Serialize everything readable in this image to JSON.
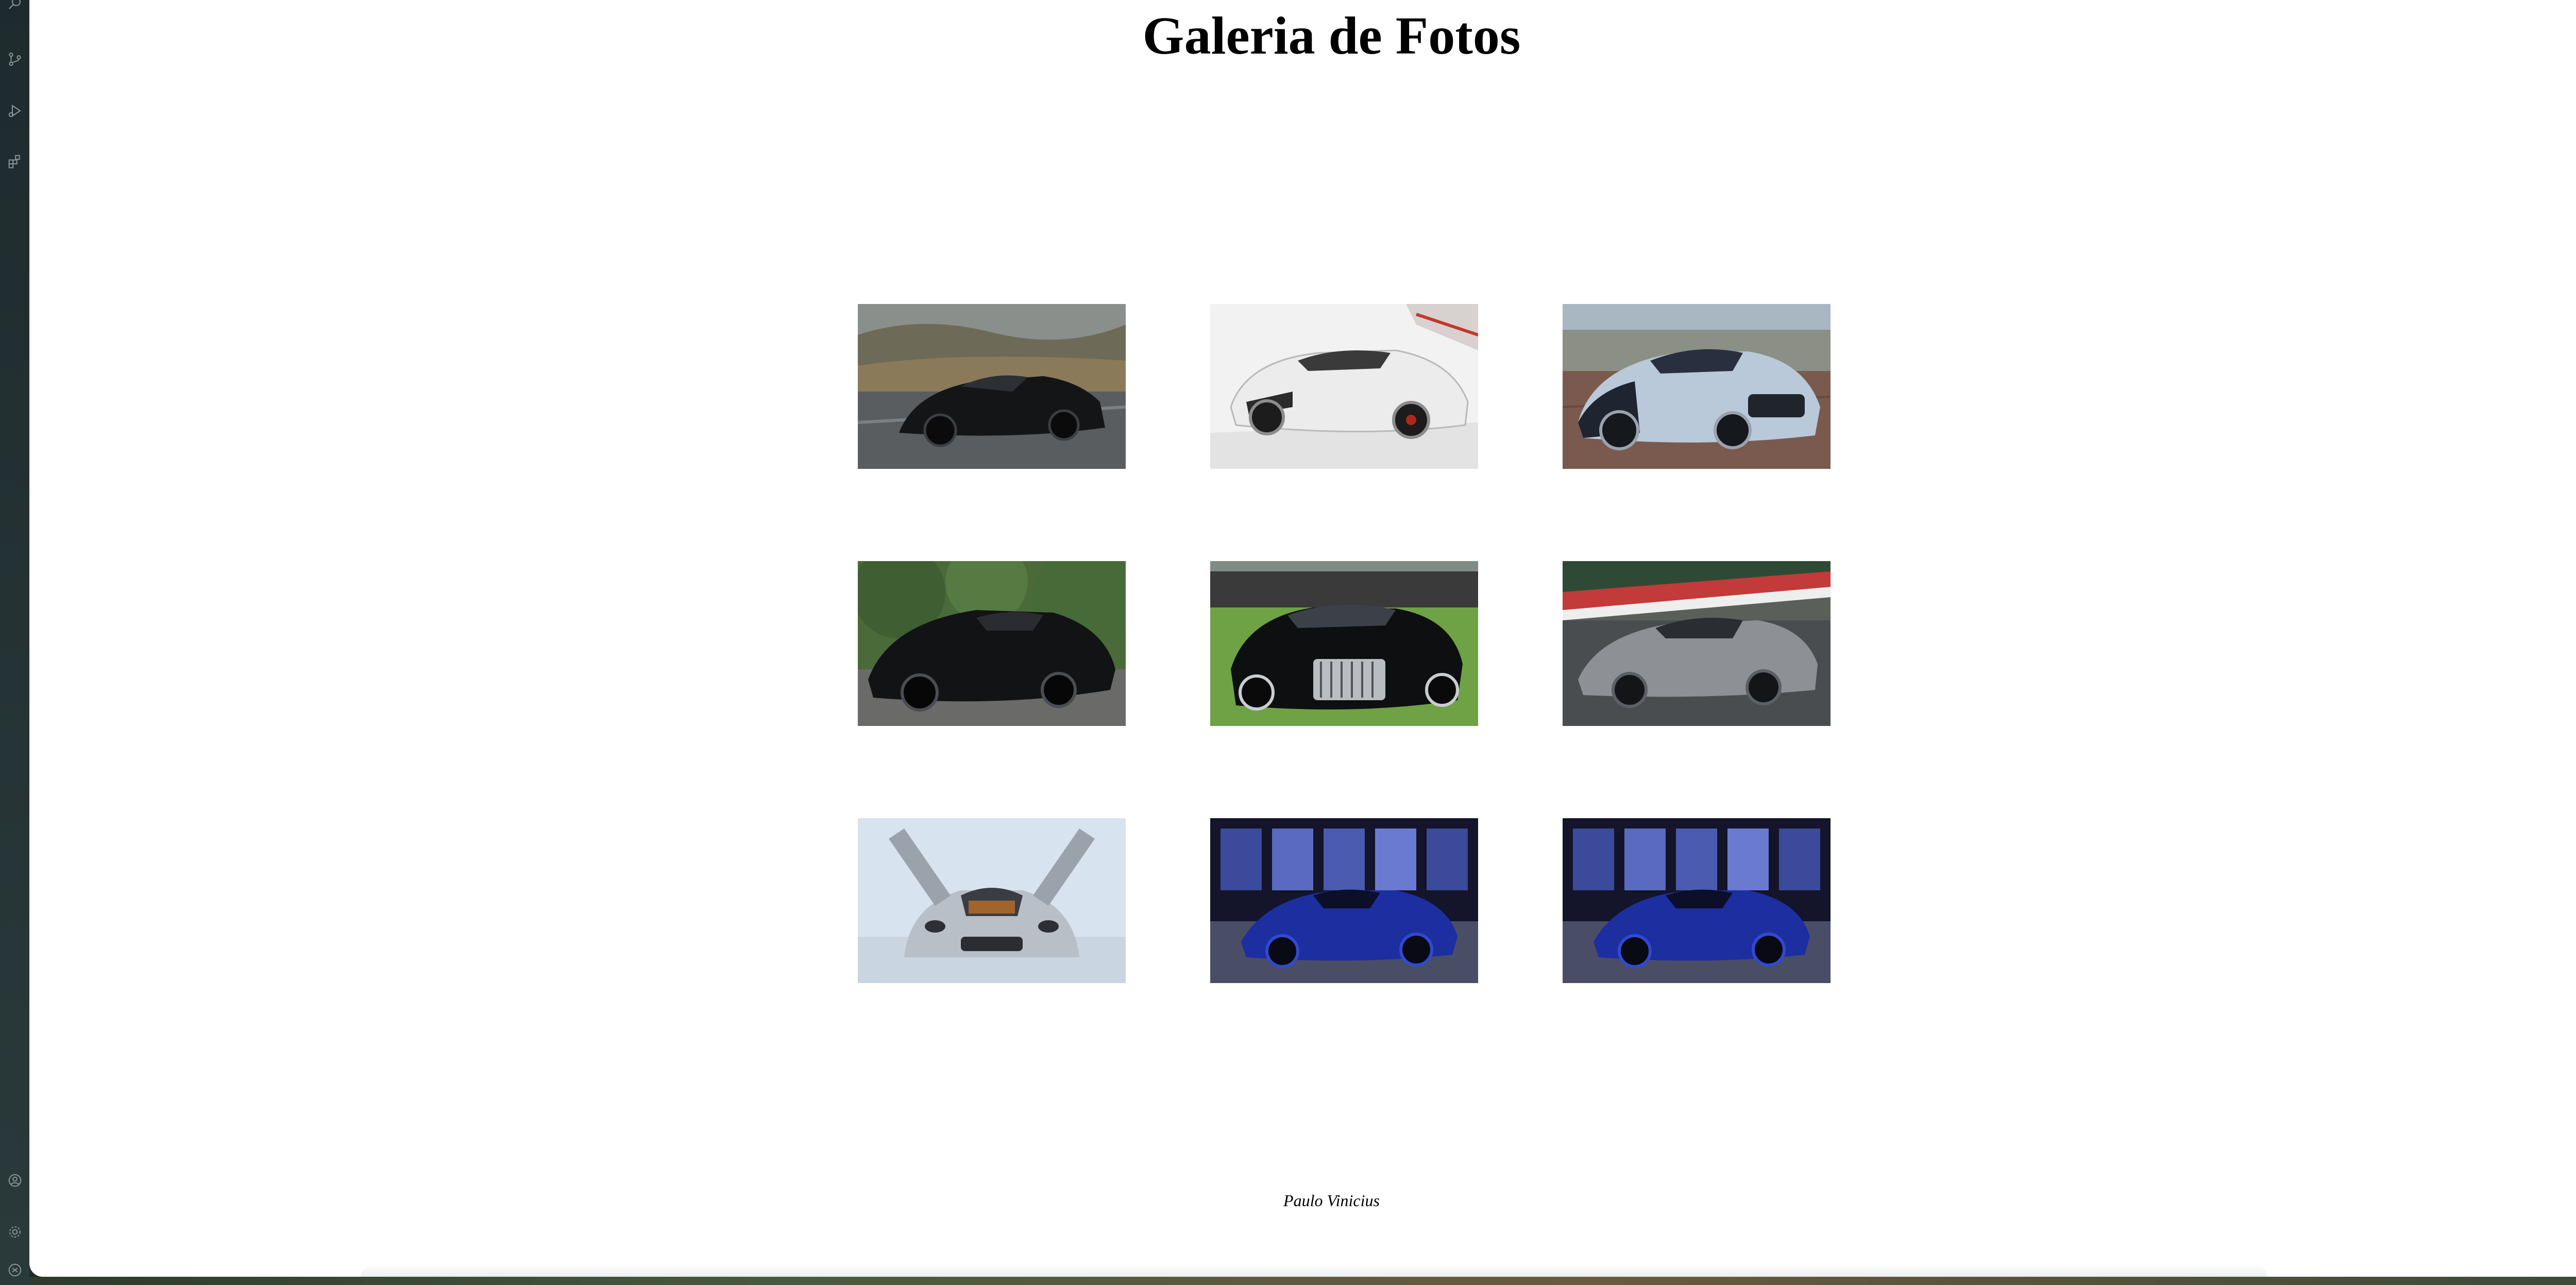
{
  "page": {
    "title": "Galeria de Fotos",
    "footer": "Paulo Vinicius"
  },
  "gallery": {
    "photos": [
      {
        "subject": "black hypercar on road",
        "scene": "mountain-road"
      },
      {
        "subject": "white hypercar on display",
        "scene": "showroom-white"
      },
      {
        "subject": "silver-blue hypercar",
        "scene": "cobblestone-city"
      },
      {
        "subject": "black hypercar",
        "scene": "garden-hedges"
      },
      {
        "subject": "black luxury car on lawn",
        "scene": "lawn-event"
      },
      {
        "subject": "grey hypercar on track",
        "scene": "race-track"
      },
      {
        "subject": "silver hypercar with gullwing doors open",
        "scene": "studio-light"
      },
      {
        "subject": "blue hypercar at exhibition",
        "scene": "exhibition-stage"
      },
      {
        "subject": "blue hypercar at exhibition",
        "scene": "exhibition-stage"
      }
    ]
  },
  "sidebar": {
    "icons": [
      "search-icon",
      "source-control-icon",
      "run-debug-icon",
      "extensions-icon",
      "account-icon",
      "settings-icon",
      "remote-icon"
    ]
  },
  "colors": {
    "editor_chrome": "#1e2b2e",
    "page_background": "#ffffff",
    "text": "#000000"
  }
}
